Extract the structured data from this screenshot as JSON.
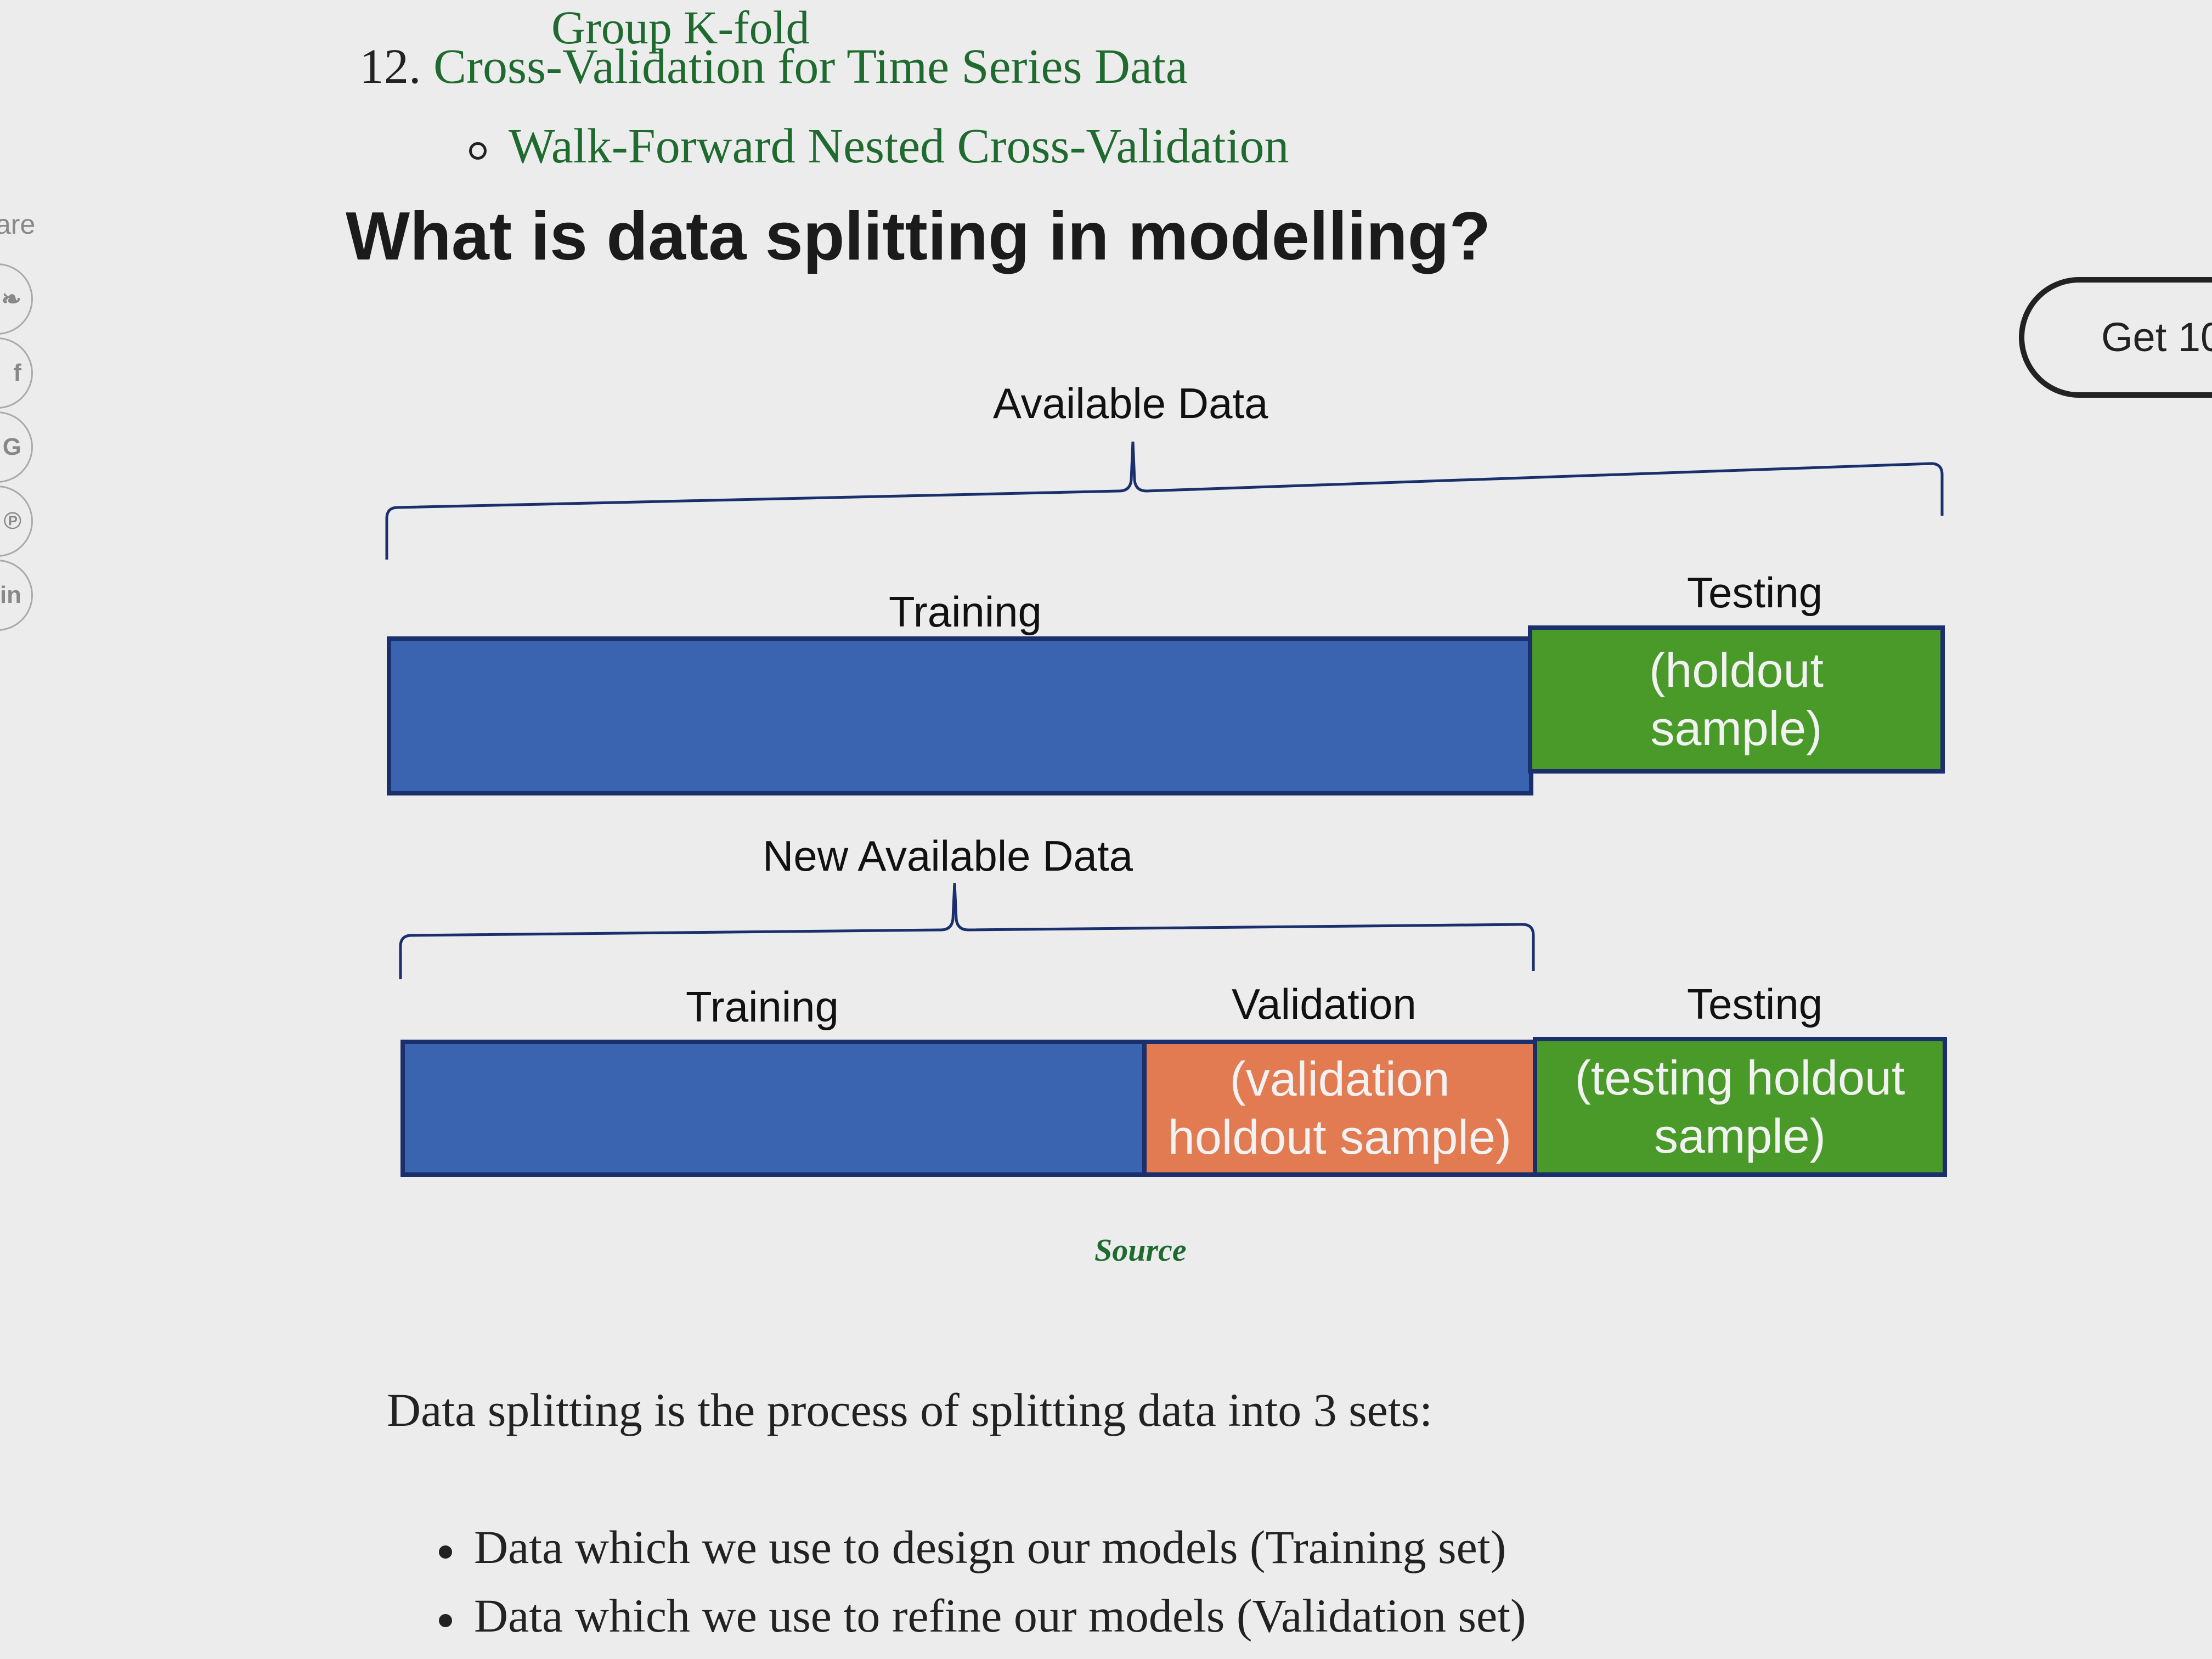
{
  "sidebar": {
    "share_label": "are",
    "share_buttons": [
      {
        "icon": "twitter-icon",
        "glyph": "❧"
      },
      {
        "icon": "facebook-icon",
        "glyph": "f"
      },
      {
        "icon": "google-icon",
        "glyph": "G"
      },
      {
        "icon": "pinterest-icon",
        "glyph": "℗"
      },
      {
        "icon": "linkedin-icon",
        "glyph": "in"
      }
    ]
  },
  "toc": {
    "partial_top": "Group K-fold",
    "item_number": "12.",
    "item_label": "Cross-Validation for Time Series Data",
    "subitem_label": "Walk-Forward Nested Cross-Validation"
  },
  "section": {
    "title": "What is data splitting in modelling?"
  },
  "cta": {
    "label": "Get 10"
  },
  "figure": {
    "top": {
      "brace_label": "Available Data",
      "training_label": "Training",
      "testing_label": "Testing",
      "testing_text": "(holdout sample)"
    },
    "bottom": {
      "brace_label": "New Available Data",
      "training_label": "Training",
      "validation_label": "Validation",
      "testing_label": "Testing",
      "validation_text": "(validation holdout sample)",
      "testing_text": "(testing holdout sample)"
    },
    "colors": {
      "training": "#3b64b0",
      "validation": "#e27a52",
      "testing": "#4a9a2a",
      "border": "#1a2f6b"
    }
  },
  "source_link": "Source",
  "body": {
    "intro": "Data splitting is the process of splitting data into 3 sets:",
    "bullets": [
      "Data which we use to design our models (Training set)",
      "Data which we use to refine our models (Validation set)"
    ]
  }
}
